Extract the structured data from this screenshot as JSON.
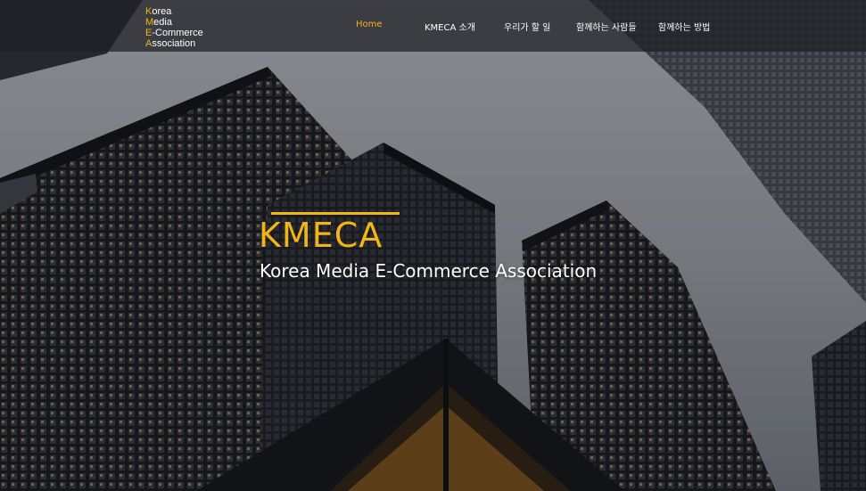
{
  "header": {
    "logo_lines": [
      {
        "first": "K",
        "rest": "orea"
      },
      {
        "first": "M",
        "rest": "edia"
      },
      {
        "first": "E",
        "rest": "-Commerce"
      },
      {
        "first": "A",
        "rest": "ssociation"
      }
    ],
    "nav": [
      {
        "label": "Home",
        "active": true
      },
      {
        "label": "KMECA 소개",
        "active": false
      },
      {
        "label": "우리가 할 일",
        "active": false
      },
      {
        "label": "함께하는 사람들",
        "active": false
      },
      {
        "label": "함께하는 방법",
        "active": false
      }
    ]
  },
  "hero": {
    "brand": "KMECA",
    "tagline": "Korea Media E-Commerce Association"
  },
  "colors": {
    "accent": "#f2b416",
    "header_bg": "#1e2026",
    "text": "#ffffff"
  }
}
